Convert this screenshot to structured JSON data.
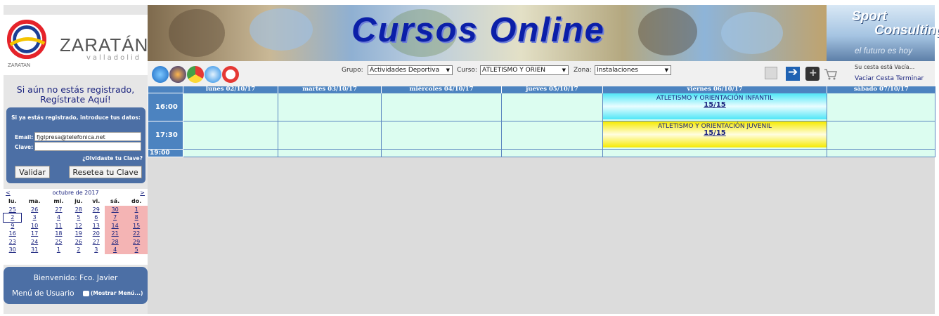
{
  "logo": {
    "name": "ZARATÁN",
    "sub": "valladolid",
    "small": "ZARATAN"
  },
  "register": {
    "line1": "Si aún no estás registrado,",
    "line2": "Regístrate Aquí!"
  },
  "login": {
    "title": "Si ya estás registrado, introduce tus datos:",
    "email_label": "Email:",
    "email_value": "fjglpresa@telefonica.net",
    "password_label": "Clave:",
    "password_value": "",
    "forgot": "¿Olvidaste tu Clave?",
    "validate_button": "Validar",
    "reset_button": "Resetea tu Clave"
  },
  "calendar": {
    "prev": "<",
    "next": ">",
    "month": "octubre de 2017",
    "weekdays": [
      "lu.",
      "ma.",
      "mi.",
      "ju.",
      "vi.",
      "sá.",
      "do."
    ],
    "weeks": [
      [
        "25",
        "26",
        "27",
        "28",
        "29",
        "30",
        "1"
      ],
      [
        "2",
        "3",
        "4",
        "5",
        "6",
        "7",
        "8"
      ],
      [
        "9",
        "10",
        "11",
        "12",
        "13",
        "14",
        "15"
      ],
      [
        "16",
        "17",
        "18",
        "19",
        "20",
        "21",
        "22"
      ],
      [
        "23",
        "24",
        "25",
        "26",
        "27",
        "28",
        "29"
      ],
      [
        "30",
        "31",
        "1",
        "2",
        "3",
        "4",
        "5"
      ]
    ]
  },
  "user": {
    "welcome": "Bienvenido: Fco. Javier",
    "menu_label": "Menú de Usuario",
    "show_menu": "(Mostrar Menú...)"
  },
  "banner": {
    "title": "Cursos Online"
  },
  "sport_consulting": {
    "line1": "Sport",
    "line2": "Consulting",
    "tagline": "el futuro es hoy"
  },
  "filters": {
    "group_label": "Grupo:",
    "group_value": "Actividades Deportiva",
    "course_label": "Curso:",
    "course_value": "ATLETISMO Y ORIEN",
    "zone_label": "Zona:",
    "zone_value": "Instalaciones"
  },
  "cart": {
    "status": "Su cesta está Vacía...",
    "empty_link": "Vaciar Cesta",
    "finish_link": "Terminar"
  },
  "schedule": {
    "days": [
      "lunes 02/10/17",
      "martes 03/10/17",
      "miércoles 04/10/17",
      "jueves 05/10/17",
      "viernes 06/10/17",
      "sábado 07/10/17"
    ],
    "times": [
      "16:00",
      "17:30",
      "19:00"
    ],
    "events": [
      {
        "name": "ATLETISMO Y ORIENTACIÓN INFANTIL",
        "count": "15/15"
      },
      {
        "name": "ATLETISMO Y ORIENTACIÓN JUVENIL",
        "count": "15/15"
      }
    ]
  },
  "colors": {
    "accent": "#4c83c0",
    "panel": "#4c6fa5",
    "cell": "#dcfdf0",
    "weekend": "#f4b4b4",
    "title": "#0b1fa8"
  }
}
